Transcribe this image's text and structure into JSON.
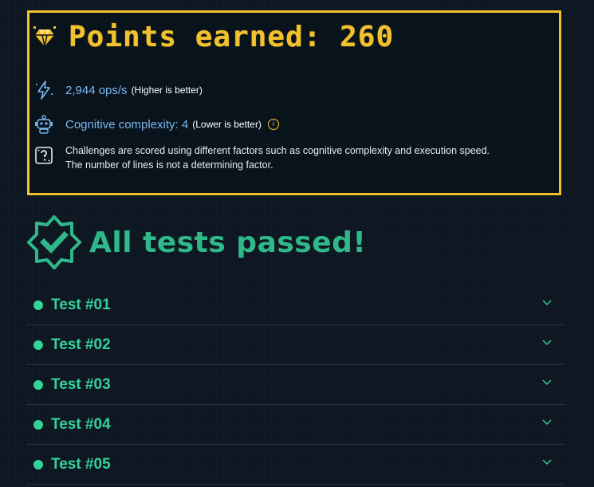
{
  "score": {
    "title": "Points earned: 260",
    "icon": "diamond-icon",
    "performance": {
      "value": "2,944 ops/s",
      "hint": "(Higher is better)",
      "icon": "lightning-icon"
    },
    "complexity": {
      "value": "Cognitive complexity: 4",
      "hint": "(Lower is better)",
      "icon": "robot-icon",
      "info_icon": "info-icon",
      "info_glyph": "i"
    },
    "note": {
      "text": "Challenges are scored using different factors such as cognitive complexity and execution speed. The number of lines is not a determining factor.",
      "icon": "question-dice-icon"
    }
  },
  "result": {
    "label": "All tests passed!",
    "icon": "check-badge-icon"
  },
  "tests": [
    {
      "name": "Test #01",
      "status": "passed"
    },
    {
      "name": "Test #02",
      "status": "passed"
    },
    {
      "name": "Test #03",
      "status": "passed"
    },
    {
      "name": "Test #04",
      "status": "passed"
    },
    {
      "name": "Test #05",
      "status": "passed"
    }
  ],
  "colors": {
    "accent": "#f2c12e",
    "success": "#34d399",
    "link": "#79b8f0",
    "background": "#0b1520"
  }
}
